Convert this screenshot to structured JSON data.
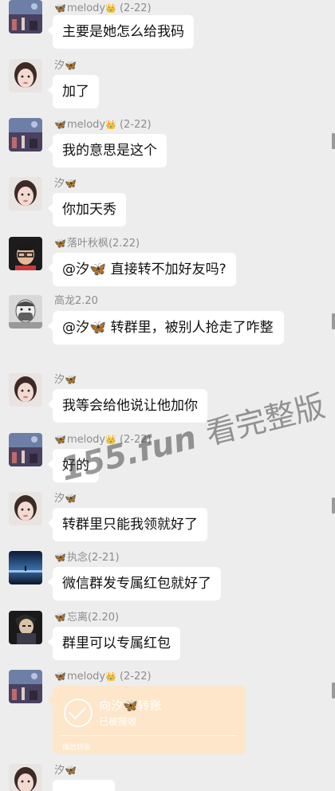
{
  "messages": [
    {
      "sender": "melody",
      "icon": "butterfly",
      "crown": true,
      "date": "(2-22)",
      "text": "主要是她怎么给我码",
      "avatar": "harbor"
    },
    {
      "sender": "汐",
      "icon": "butterfly",
      "text": "加了",
      "avatar": "girl"
    },
    {
      "sender": "melody",
      "icon": "butterfly",
      "crown": true,
      "date": "(2-22)",
      "text": "我的意思是这个",
      "avatar": "harbor"
    },
    {
      "sender": "汐",
      "icon": "butterfly",
      "text": "你加天秀",
      "avatar": "girl"
    },
    {
      "sender": "落叶秋枫",
      "icon": "butterfly",
      "date": "(2.22)",
      "mention": "@汐",
      "text": "直接转不加好友吗?",
      "avatar": "man-glasses"
    },
    {
      "sender": "高龙2.20",
      "mention": "@汐",
      "text": "转群里，被别人抢走了咋整",
      "avatar": "masked"
    },
    {
      "sender": "汐",
      "icon": "butterfly",
      "text": "我等会给他说让他加你",
      "avatar": "girl"
    },
    {
      "sender": "melody",
      "icon": "butterfly",
      "crown": true,
      "date": "(2-22)",
      "text": "好的",
      "avatar": "harbor"
    },
    {
      "sender": "汐",
      "icon": "butterfly",
      "text": "转群里只能我领就好了",
      "avatar": "girl"
    },
    {
      "sender": "执念",
      "icon": "butterfly",
      "date": "(2-21)",
      "text": "微信群发专属红包就好了",
      "avatar": "lake"
    },
    {
      "sender": "忘离",
      "icon": "butterfly",
      "date": "(2.20)",
      "text": "群里可以专属红包",
      "avatar": "anime"
    },
    {
      "sender": "melody",
      "icon": "butterfly",
      "crown": true,
      "date": "(2-22)",
      "avatar": "harbor",
      "transfer": {
        "title": "向汐🦋转账",
        "status": "已被接收",
        "footer": "微信转账"
      }
    },
    {
      "sender": "汐",
      "icon": "butterfly",
      "avatar": "girl"
    }
  ],
  "watermark": {
    "latin": "155.fun",
    "han": "看完整版"
  },
  "colors": {
    "background": "#ededed",
    "bubble": "#ffffff",
    "transfer": "#fde6c9",
    "butterfly": "#3aa0d8"
  }
}
